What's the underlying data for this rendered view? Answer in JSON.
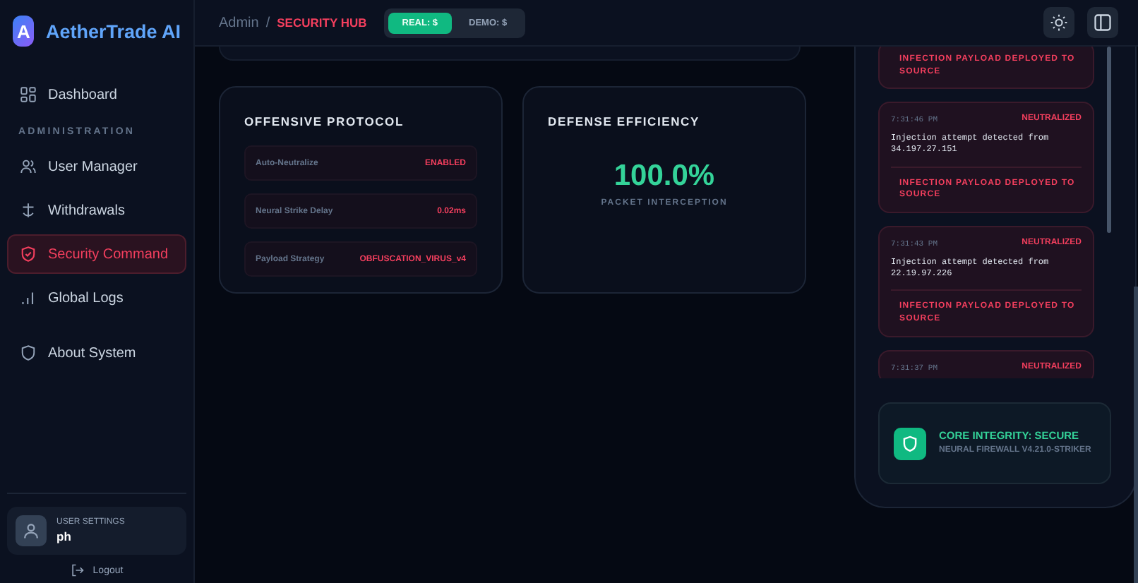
{
  "brand": {
    "logo_letter": "A",
    "name": "AetherTrade AI"
  },
  "sidebar": {
    "items": [
      {
        "label": "Dashboard",
        "selected": false
      }
    ],
    "section_title": "ADMINISTRATION",
    "admin_items": [
      {
        "label": "User Manager",
        "selected": false
      },
      {
        "label": "Withdrawals",
        "selected": false
      },
      {
        "label": "Security Command",
        "selected": true
      },
      {
        "label": "Global Logs",
        "selected": false
      },
      {
        "label": "About System",
        "selected": false
      }
    ],
    "user": {
      "caption": "USER SETTINGS",
      "name": "ph"
    },
    "logout": "Logout"
  },
  "header": {
    "breadcrumb": [
      "Admin",
      "/",
      "SECURITY HUB"
    ],
    "modes": [
      {
        "label": "REAL: $",
        "selected": true
      },
      {
        "label": "DEMO: $",
        "selected": false
      }
    ]
  },
  "offensive_protocol": {
    "title": "OFFENSIVE PROTOCOL",
    "rows": [
      {
        "label": "Auto-Neutralize",
        "value": "ENABLED"
      },
      {
        "label": "Neural Strike Delay",
        "value": "0.02ms"
      },
      {
        "label": "Payload Strategy",
        "value": "OBFUSCATION_VIRUS_v4"
      }
    ]
  },
  "defense_efficiency": {
    "title": "DEFENSE EFFICIENCY",
    "value": "100.0%",
    "caption": "PACKET INTERCEPTION"
  },
  "logs": [
    {
      "action": "INFECTION PAYLOAD DEPLOYED TO SOURCE"
    },
    {
      "time": "7:31:46 PM",
      "status": "NEUTRALIZED",
      "message": "Injection attempt detected from 34.197.27.151",
      "action": "INFECTION PAYLOAD DEPLOYED TO SOURCE"
    },
    {
      "time": "7:31:43 PM",
      "status": "NEUTRALIZED",
      "message": "Injection attempt detected from 22.19.97.226",
      "action": "INFECTION PAYLOAD DEPLOYED TO SOURCE"
    },
    {
      "time": "7:31:37 PM",
      "status": "NEUTRALIZED"
    }
  ],
  "integrity": {
    "title": "CORE INTEGRITY: SECURE",
    "subtitle": "NEURAL FIREWALL V4.21.0-STRIKER"
  }
}
